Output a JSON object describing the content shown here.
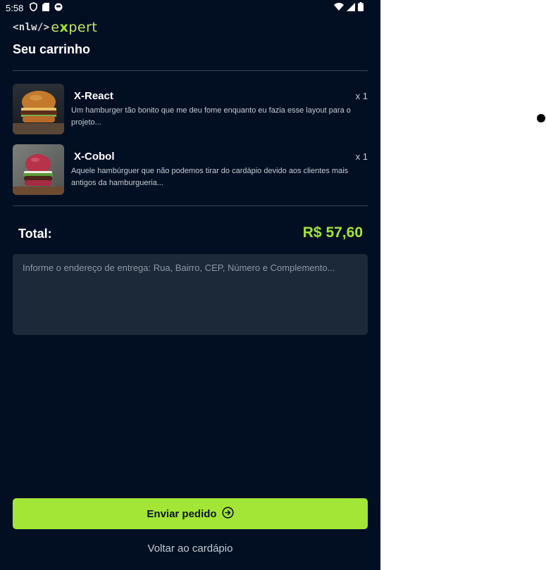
{
  "status_bar": {
    "time": "5:58",
    "left_icons": [
      "shield-icon",
      "sd-card-icon",
      "app-notification-icon"
    ],
    "right_icons": [
      "wifi-icon",
      "signal-icon",
      "battery-icon"
    ]
  },
  "header": {
    "logo_part1": "<nlw/>",
    "logo_part2_before_x": "e",
    "logo_part2_x": "x",
    "logo_part2_after_x": "pert",
    "title": "Seu carrinho"
  },
  "cart": {
    "items": [
      {
        "name": "X-React",
        "quantity": "x 1",
        "description": "Um hamburger tão bonito que me deu fome enquanto eu fazia esse layout para o projeto...",
        "image": "burger-photo"
      },
      {
        "name": "X-Cobol",
        "quantity": "x 1",
        "description": "Aquele hambúrguer que não podemos tirar do cardápio devido aos clientes mais antigos da hamburgueria...",
        "image": "burger-photo"
      }
    ]
  },
  "total": {
    "label": "Total:",
    "value": "R$ 57,60"
  },
  "address": {
    "placeholder": "Informe o endereço de entrega: Rua, Bairro, CEP, Número e Complemento...",
    "value": ""
  },
  "actions": {
    "send_label": "Enviar pedido",
    "send_icon": "arrow-circle-right-icon",
    "back_label": "Voltar ao cardápio"
  },
  "colors": {
    "background": "#020f23",
    "accent": "#a3e635",
    "input_bg": "#1c2938"
  }
}
